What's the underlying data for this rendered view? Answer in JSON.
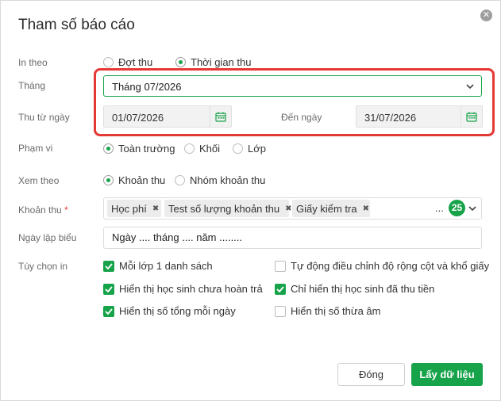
{
  "dialog": {
    "title": "Tham số báo cáo",
    "close_icon": "close-icon"
  },
  "in_theo": {
    "label": "In theo",
    "options": [
      "Đợt thu",
      "Thời gian thu"
    ],
    "selected": "Thời gian thu"
  },
  "thang": {
    "label": "Tháng",
    "value": "Tháng 07/2026"
  },
  "thu_tu_ngay": {
    "label": "Thu từ ngày",
    "from_value": "01/07/2026",
    "to_label": "Đến ngày",
    "to_value": "31/07/2026",
    "calendar_icon": "calendar-icon"
  },
  "pham_vi": {
    "label": "Phạm vi",
    "options": [
      "Toàn trường",
      "Khối",
      "Lớp"
    ],
    "selected": "Toàn trường"
  },
  "xem_theo": {
    "label": "Xem theo",
    "options": [
      "Khoản thu",
      "Nhóm khoản thu"
    ],
    "selected": "Khoản thu"
  },
  "khoan_thu": {
    "label": "Khoản thu",
    "required_mark": "*",
    "tags": [
      "Học phí",
      "Test số lượng khoản thu",
      "Giấy kiểm tra"
    ],
    "ellipsis": "...",
    "count": "25"
  },
  "ngay_lap_bieu": {
    "label": "Ngày lập biểu",
    "value": "Ngày .... tháng .... năm ........"
  },
  "tuy_chon_in": {
    "label": "Tùy chọn in",
    "options": [
      {
        "label": "Mỗi lớp 1 danh sách",
        "checked": true
      },
      {
        "label": "Tự động điều chỉnh độ rộng cột và khổ giấy",
        "checked": false
      },
      {
        "label": "Hiển thị học sinh chưa hoàn trả",
        "checked": true
      },
      {
        "label": "Chỉ hiển thị học sinh đã thu tiền",
        "checked": true
      },
      {
        "label": "Hiển thị số tổng mỗi ngày",
        "checked": true
      },
      {
        "label": "Hiển thị số thừa âm",
        "checked": false
      }
    ]
  },
  "buttons": {
    "close": "Đóng",
    "submit": "Lấy dữ liệu"
  },
  "colors": {
    "accent": "#16a34a",
    "highlight": "#e53935"
  }
}
